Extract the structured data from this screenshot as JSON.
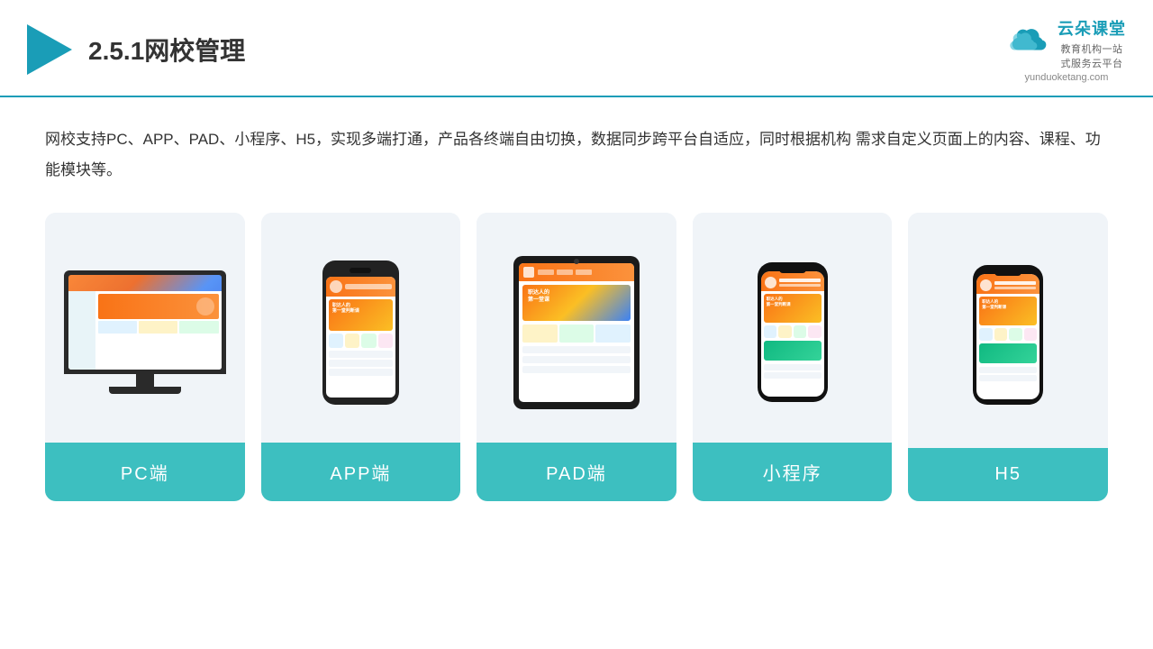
{
  "header": {
    "title": "2.5.1网校管理",
    "logo_name": "云朵课堂",
    "logo_url": "yunduoketang.com",
    "logo_tagline": "教育机构一站\n式服务云平台"
  },
  "description": "网校支持PC、APP、PAD、小程序、H5，实现多端打通，产品各终端自由切换，数据同步跨平台自适应，同时根据机构\n需求自定义页面上的内容、课程、功能模块等。",
  "cards": [
    {
      "id": "pc",
      "label": "PC端"
    },
    {
      "id": "app",
      "label": "APP端"
    },
    {
      "id": "pad",
      "label": "PAD端"
    },
    {
      "id": "miniprogram",
      "label": "小程序"
    },
    {
      "id": "h5",
      "label": "H5"
    }
  ],
  "colors": {
    "accent": "#1a9db7",
    "card_bg": "#f0f4f8",
    "label_bg": "#3dbfc0",
    "text_dark": "#333333"
  }
}
